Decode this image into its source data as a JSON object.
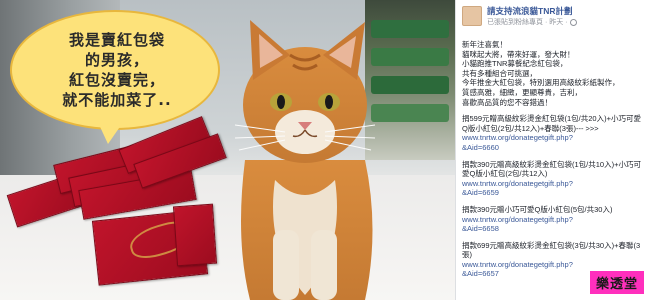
{
  "photo": {
    "bubble_lines": [
      "我是賣紅包袋",
      "的男孩，",
      "紅包沒賣完，",
      "就不能加菜了.."
    ]
  },
  "post": {
    "author": "請支持流浪貓TNR計劃",
    "meta_text": "已張貼到粉絲專頁 · 昨天 ·",
    "intro_lines": [
      "新年注喜氣！",
      "貓咪起大將，帶來好運，發大財！",
      "小貓跑推TNR募餐紀念紅包袋，",
      "共有多種組合可挑選，",
      "今年推金大紅包袋，特別選用高級紋彩紙製作，",
      "質感高雅，細緻，更顯尊貴，吉利，",
      "喜歡高品質的您不容錯過！"
    ],
    "items": [
      {
        "text": "捐599元贈高級紋彩燙金紅包袋(1包/共20入)+小巧可愛Q版小紅包(2包/共12入)+春聯(3張)--- >>>",
        "link": "www.tnrtw.org/donategetgift.php?",
        "aid": "&Aid=6660"
      },
      {
        "text": "捐款390元贈高級紋彩燙金紅包袋(1包/共10入)+小巧可愛Q版小紅包(2包/共12入)",
        "link": "www.tnrtw.org/donategetgift.php?",
        "aid": "&Aid=6659"
      },
      {
        "text": "捐款390元贈小巧可愛Q版小紅包(5包/共30入)",
        "link": "www.tnrtw.org/donategetgift.php?",
        "aid": "&Aid=6658"
      },
      {
        "text": "捐款699元贈高級紋彩燙金紅包袋(3包/共30入)+春聯(3張)",
        "link": "www.tnrtw.org/donategetgift.php?",
        "aid": "&Aid=6657"
      }
    ]
  },
  "watermark": "樂透堂",
  "colors": {
    "link": "#3b5998",
    "bubble": "#fde27a",
    "envelope": "#c0142b",
    "watermark_bg": "#ff2fbd"
  }
}
